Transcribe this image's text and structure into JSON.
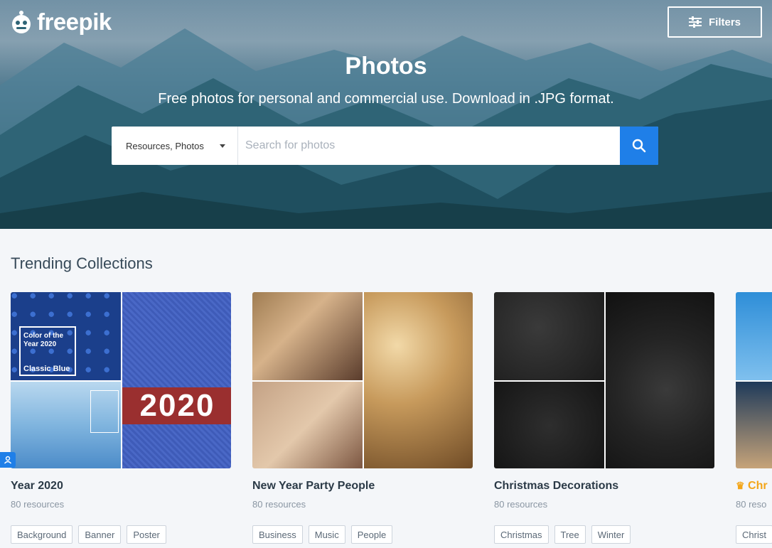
{
  "brand": {
    "name": "freepik"
  },
  "header": {
    "filters_label": "Filters"
  },
  "hero": {
    "title": "Photos",
    "subtitle": "Free photos for personal and commercial use. Download in .JPG format.",
    "search_type": "Resources, Photos",
    "search_placeholder": "Search for photos"
  },
  "collections": {
    "title": "Trending Collections",
    "items": [
      {
        "title": "Year 2020",
        "count": "80 resources",
        "tags": [
          "Background",
          "Banner",
          "Poster"
        ],
        "image_text": {
          "badge": "Color of the Year 2020",
          "caption": "Classic Blue",
          "banner": "2020"
        }
      },
      {
        "title": "New Year Party People",
        "count": "80 resources",
        "tags": [
          "Business",
          "Music",
          "People"
        ]
      },
      {
        "title": "Christmas Decorations",
        "count": "80 resources",
        "tags": [
          "Christmas",
          "Tree",
          "Winter"
        ]
      },
      {
        "title": "Chr",
        "count": "80 reso",
        "tags": [
          "Christ"
        ]
      }
    ]
  },
  "colors": {
    "accent": "#1f7fe8",
    "premium": "#f3a518",
    "text": "#2b3a47"
  }
}
